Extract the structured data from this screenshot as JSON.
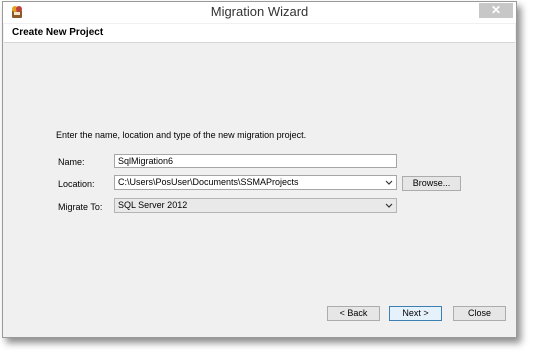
{
  "window": {
    "title": "Migration Wizard",
    "close_glyph": "✕"
  },
  "header": {
    "title": "Create New Project"
  },
  "form": {
    "intro": "Enter the name, location and type of the new migration project.",
    "name_label": "Name:",
    "name_value": "SqlMigration6",
    "location_label": "Location:",
    "location_value": "C:\\Users\\PosUser\\Documents\\SSMAProjects",
    "browse_label": "Browse...",
    "migrate_label": "Migrate To:",
    "migrate_value": "SQL Server 2012"
  },
  "buttons": {
    "back": "< Back",
    "next": "Next >",
    "close": "Close"
  },
  "icons": {
    "app": "ssma-app-icon",
    "close": "close-icon",
    "dropdown": "chevron-down-icon"
  }
}
